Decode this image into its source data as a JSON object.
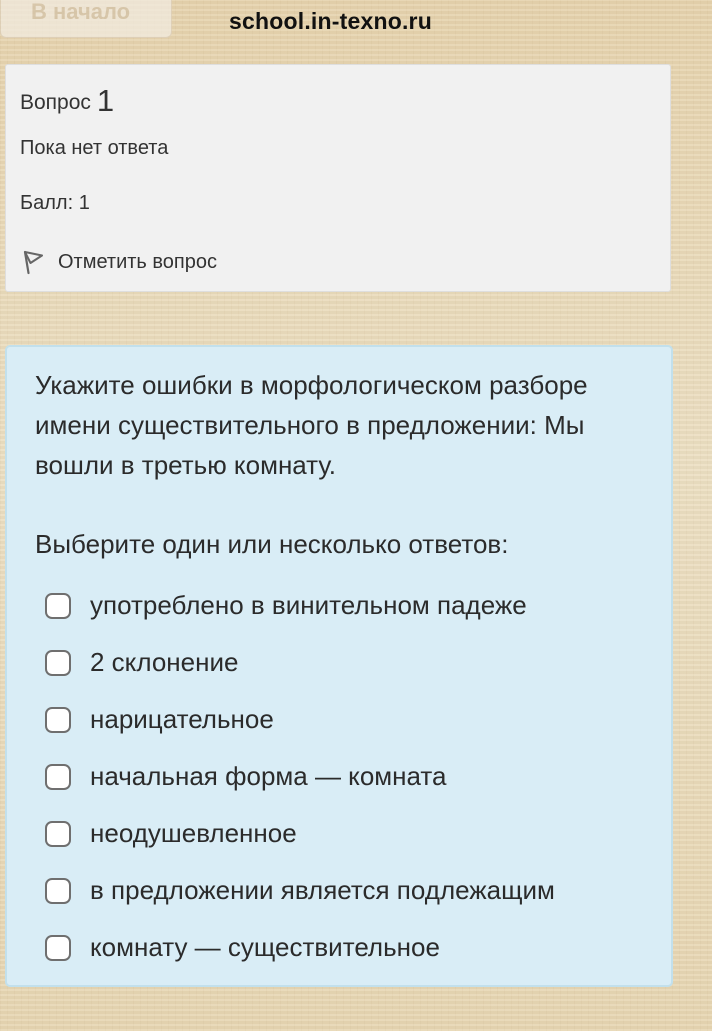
{
  "header": {
    "back_button_label": "В начало",
    "watermark": "school.in-texno.ru"
  },
  "info": {
    "question_label": "Вопрос",
    "question_number": "1",
    "status": "Пока нет ответа",
    "grade": "Балл: 1",
    "flag_label": "Отметить вопрос",
    "flag_icon": "flag-icon"
  },
  "question": {
    "text": "Укажите ошибки в морфологическом разборе имени существительного в предложении: Мы вошли в третью комнату.",
    "prompt": "Выберите один или несколько ответов:",
    "options": [
      "употреблено в винительном падеже",
      "2 склонение",
      "нарицательное",
      "начальная форма — комната",
      "неодушевленное",
      "в предложении является подлежащим",
      "комнату — существительное"
    ]
  },
  "colors": {
    "info_card_bg": "#f1f1f1",
    "question_card_bg": "#d9edf6",
    "question_card_border": "#c2e0ec",
    "page_bg": "#e9d9b6"
  }
}
